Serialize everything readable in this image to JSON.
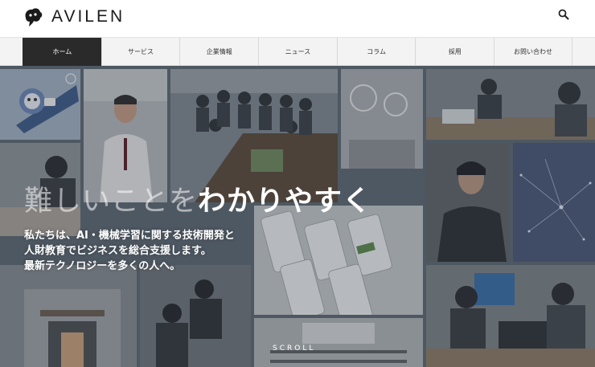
{
  "brand": {
    "name": "AVILEN",
    "logo_icon": "avilen-logo-icon"
  },
  "header": {
    "search_icon": "search-icon"
  },
  "nav": {
    "items": [
      {
        "label": "ホーム",
        "active": true
      },
      {
        "label": "サービス",
        "active": false
      },
      {
        "label": "企業情報",
        "active": false
      },
      {
        "label": "ニュース",
        "active": false
      },
      {
        "label": "コラム",
        "active": false
      },
      {
        "label": "採用",
        "active": false
      },
      {
        "label": "お問い合わせ",
        "active": false
      }
    ]
  },
  "hero": {
    "headline_light": "難しいことを",
    "headline_bold": "わかりやすく",
    "copy": [
      "私たちは、AI・機械学習に関する技術開発と",
      "人財教育でビジネスを総合支援します。",
      "最新テクノロジーを多くの人へ。"
    ],
    "scroll_label": "SCROLL"
  },
  "colors": {
    "nav_active_bg": "#2a2a2a",
    "nav_bg": "#f3f3f3"
  }
}
